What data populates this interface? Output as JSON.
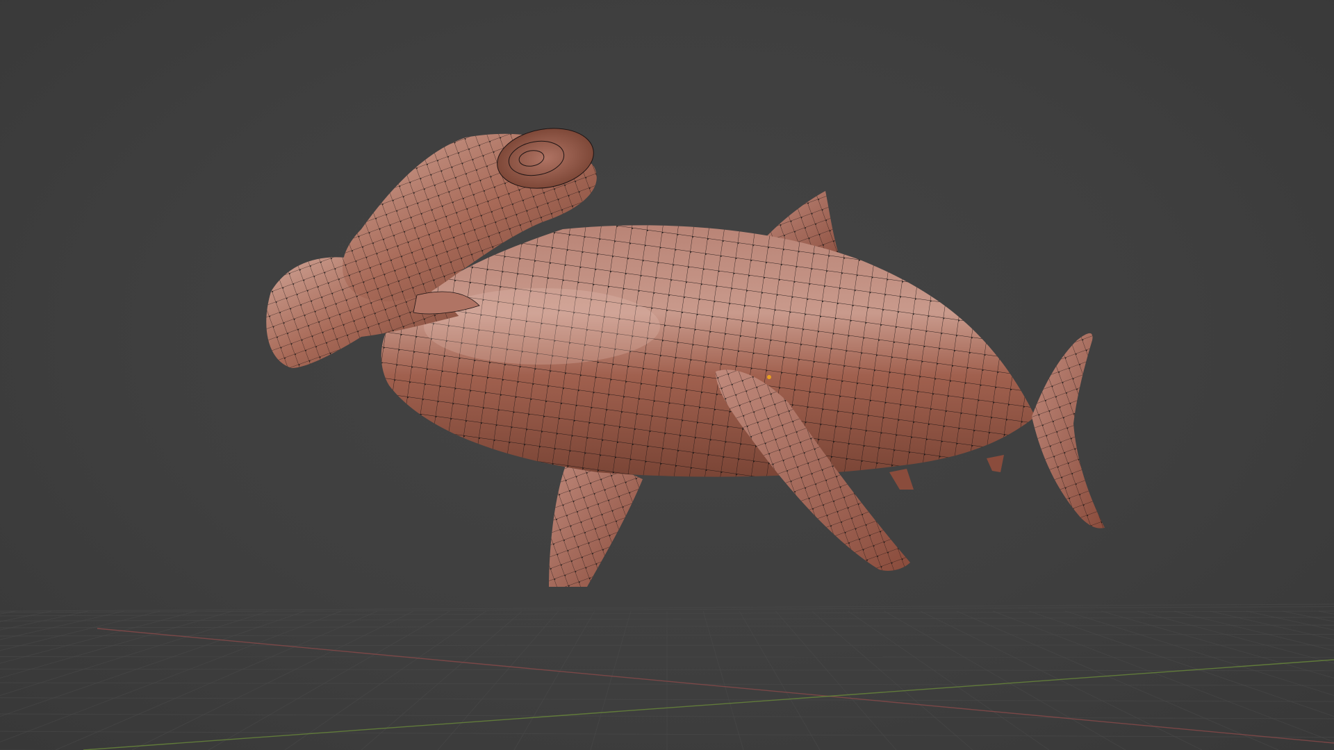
{
  "viewport": {
    "background_color": "#3d3d3d",
    "grid_line_color": "#4a4a4a",
    "x_axis_color": "#8a4a4a",
    "y_axis_color": "#6a8a3a",
    "object": {
      "name": "hammerhead-shark-mesh",
      "mode": "edit",
      "surface_color": "#a0604e",
      "surface_highlight": "#d9a89a",
      "surface_shadow": "#6e3a2e",
      "wire_color": "#1e1414",
      "vertex_color": "#111111"
    },
    "origin_marker_color": "#e8a020"
  }
}
